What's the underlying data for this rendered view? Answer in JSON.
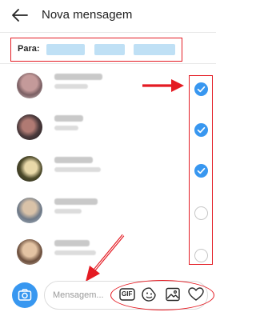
{
  "header": {
    "title": "Nova mensagem",
    "back_icon": "arrow-left-icon"
  },
  "recipients": {
    "label": "Para:",
    "chip_count": 3
  },
  "contacts": [
    {
      "selected": true
    },
    {
      "selected": true
    },
    {
      "selected": true
    },
    {
      "selected": false
    },
    {
      "selected": false
    }
  ],
  "composer": {
    "placeholder": "Mensagem...",
    "icons": [
      "camera-icon",
      "gif-icon",
      "sticker-icon",
      "gallery-icon",
      "heart-icon"
    ],
    "gif_label": "GIF"
  },
  "colors": {
    "accent": "#3897f0",
    "annotation": "#e41b23"
  }
}
